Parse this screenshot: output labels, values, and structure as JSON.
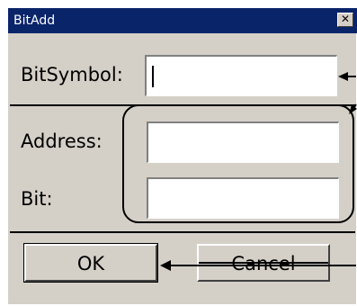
{
  "dialog": {
    "title": "BitAdd",
    "close_glyph": "✕"
  },
  "fields": {
    "bit_symbol": {
      "label": "BitSymbol:",
      "value": ""
    },
    "address": {
      "label": "Address:",
      "value": ""
    },
    "bit": {
      "label": "Bit:",
      "value": ""
    }
  },
  "buttons": {
    "ok_label": "OK",
    "cancel_label": "Cancel"
  },
  "colors": {
    "titlebar": "#0a246a",
    "dialog_bg": "#d4d0c8"
  }
}
